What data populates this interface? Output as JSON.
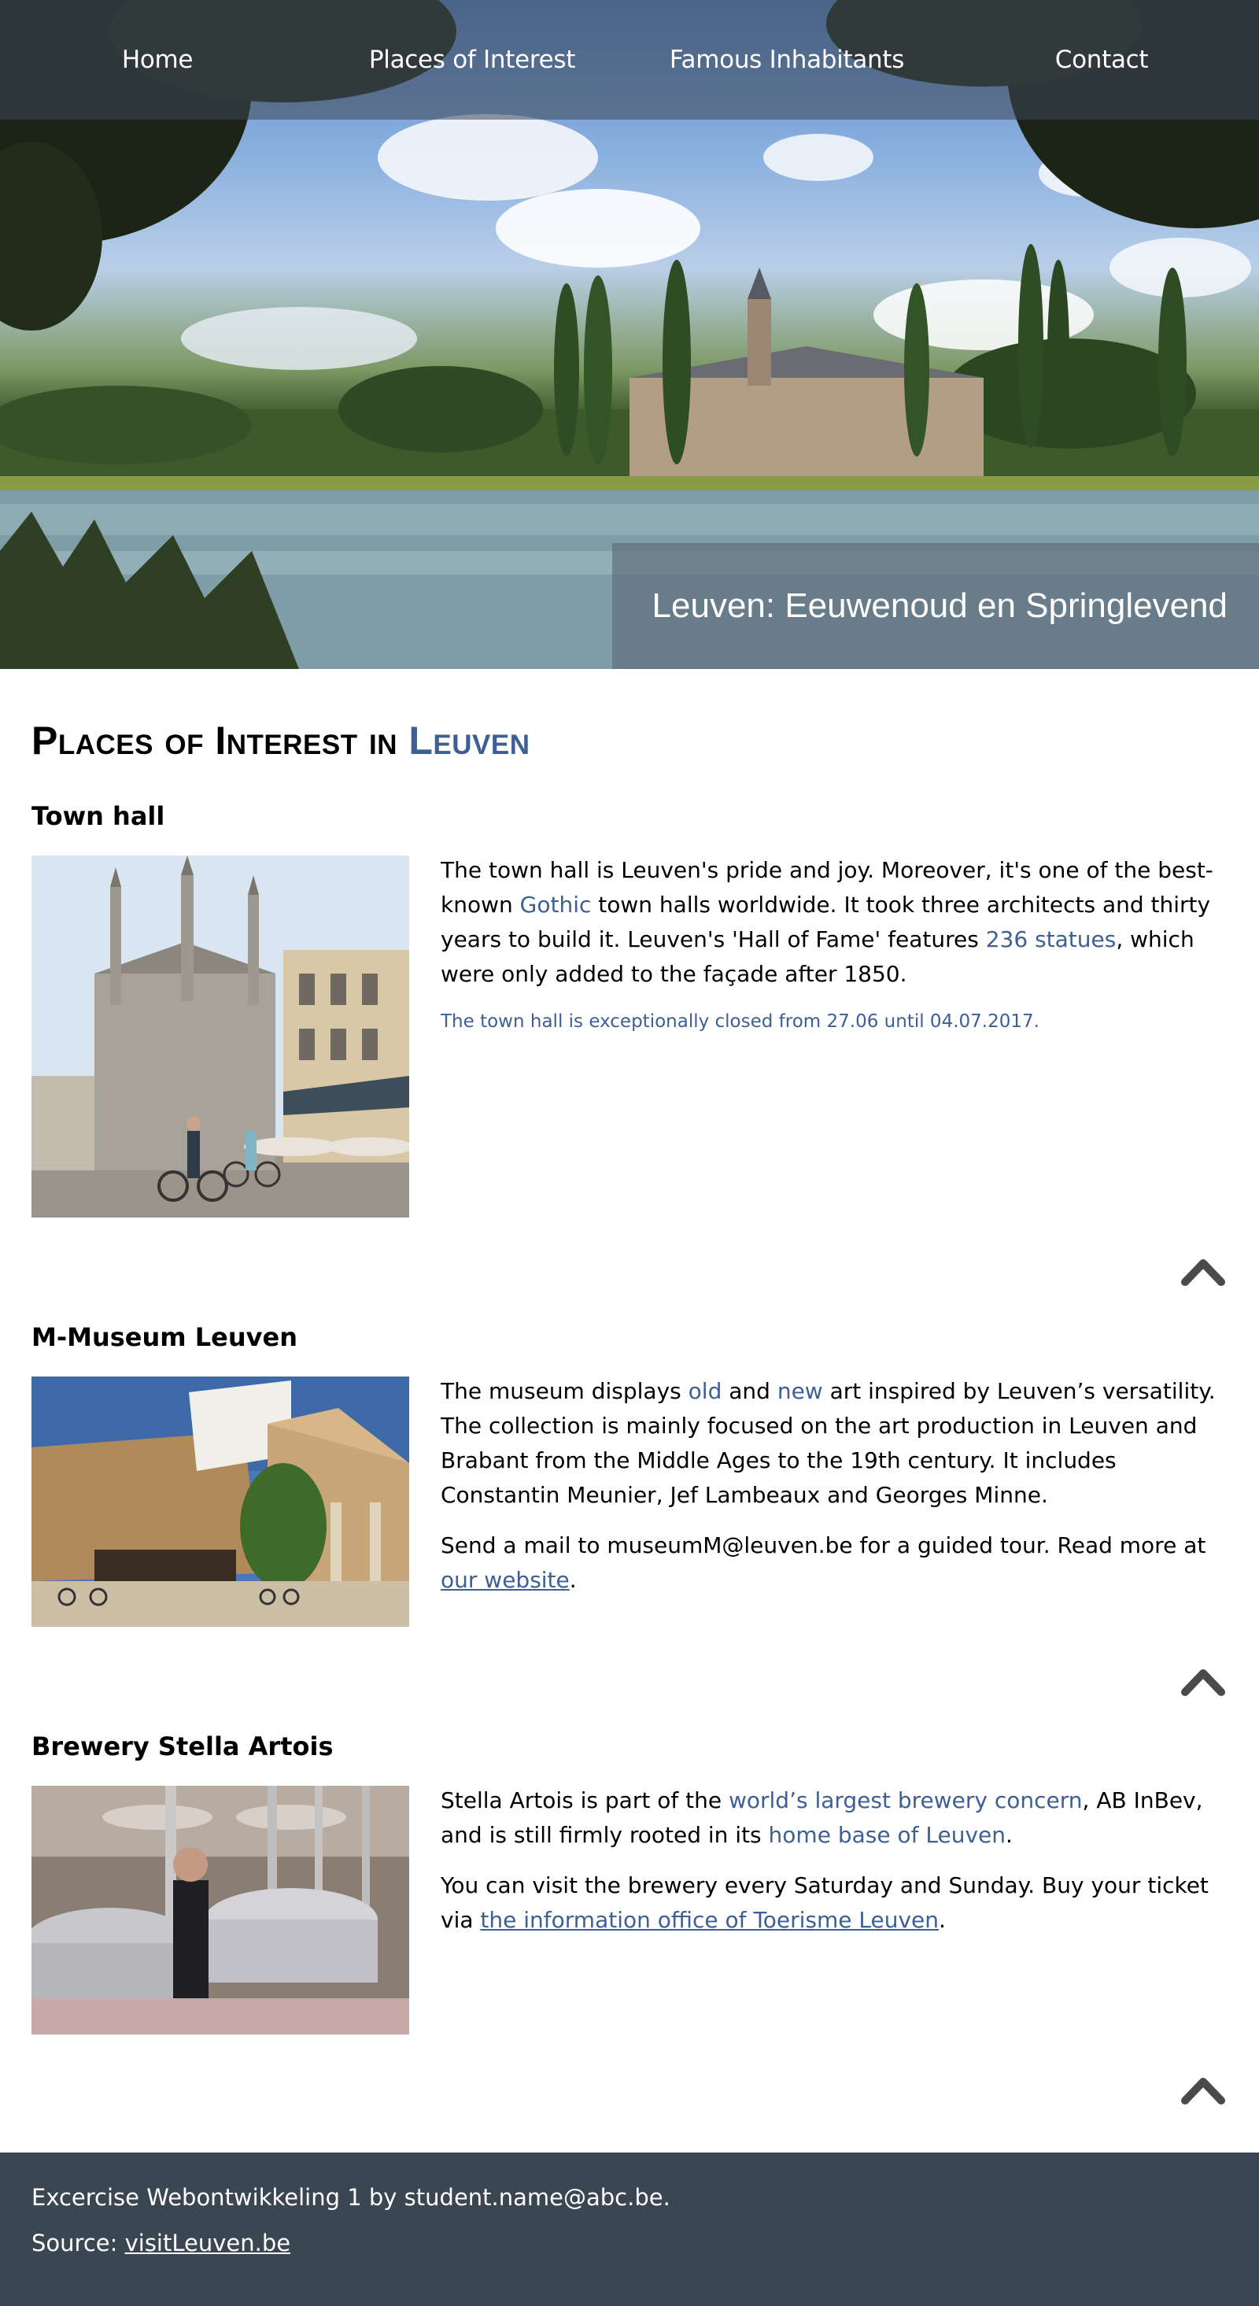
{
  "nav": {
    "items": [
      "Home",
      "Places of Interest",
      "Famous Inhabitants",
      "Contact"
    ]
  },
  "hero": {
    "caption": "Leuven: Eeuwenoud en Springlevend"
  },
  "page_title": {
    "prefix": "Places of Interest in ",
    "accent": "Leuven"
  },
  "sections": [
    {
      "title": "Town hall",
      "image_alt": "Town hall of Leuven",
      "p1": {
        "t1": "The town hall is Leuven's pride and joy. Moreover, it's one of the best-known ",
        "h1": "Gothic",
        "t2": " town halls worldwide. It took three architects and thirty years to build it. Leuven's 'Hall of Fame' features ",
        "h2": "236 statues",
        "t3": ", which were only added to the façade after 1850."
      },
      "note": "The town hall is exceptionally closed from 27.06 until 04.07.2017."
    },
    {
      "title": "M-Museum Leuven",
      "image_alt": "M-Museum Leuven building",
      "p1": {
        "t1": "The museum displays ",
        "h1": "old",
        "t2": " and ",
        "h2": "new",
        "t3": " art inspired by Leuven’s versatility. The collection is mainly focused on the art production in Leuven and Brabant from the Middle Ages to the 19th century. It includes Constantin Meunier, Jef Lambeaux and Georges Minne."
      },
      "p2": {
        "t1": "Send a mail to museumM@leuven.be for a guided tour. Read more at ",
        "link": "our website",
        "t2": "."
      }
    },
    {
      "title": "Brewery Stella Artois",
      "image_alt": "Brewery Stella Artois brew hall",
      "p1": {
        "t1": "Stella Artois is part of the ",
        "h1": "world’s largest brewery concern",
        "t2": ", AB InBev, and is still firmly rooted in its ",
        "h2": "home base of Leuven",
        "t3": "."
      },
      "p2": {
        "t1": "You can visit the brewery every Saturday and Sunday. Buy your ticket via ",
        "link": "the information office of Toerisme Leuven",
        "t2": "."
      }
    }
  ],
  "footer": {
    "line1": "Excercise Webontwikkeling 1 by student.name@abc.be.",
    "source_label": "Source: ",
    "source_link": "visitLeuven.be"
  },
  "colors": {
    "accent": "#3d5f94",
    "footer_bg": "#3a4652",
    "nav_overlay": "rgba(60,70,85,0.55)"
  }
}
